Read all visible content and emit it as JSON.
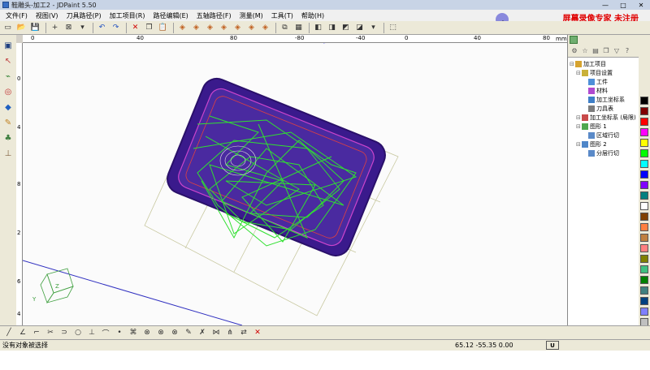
{
  "window": {
    "title": "鞋雕头-加工2 - JDPaint 5.50",
    "min": "—",
    "max": "□",
    "close": "✕"
  },
  "menu": [
    "文件(F)",
    "视图(V)",
    "刀具路径(P)",
    "加工项目(R)",
    "路径编辑(E)",
    "五轴路径(F)",
    "测量(M)",
    "工具(T)",
    "帮助(H)"
  ],
  "watermark": "屏幕录像专家 未注册",
  "ruler": {
    "unit": "mm",
    "top_labels": [
      "0",
      "40",
      "80",
      "-80",
      "-40",
      "0",
      "40",
      "80"
    ],
    "left_labels": [
      "0",
      "4",
      "8",
      "2",
      "6",
      "4"
    ]
  },
  "tree": [
    {
      "label": "加工项目",
      "depth": 0,
      "icon": "folder-icon",
      "color": "#d6a32f"
    },
    {
      "label": "项目设置",
      "depth": 1,
      "icon": "settings-icon",
      "color": "#c9b13a"
    },
    {
      "label": "工件",
      "depth": 2,
      "icon": "workpiece-icon",
      "color": "#4e8fd8"
    },
    {
      "label": "材料",
      "depth": 2,
      "icon": "material-icon",
      "color": "#b04ad0"
    },
    {
      "label": "加工坐标系",
      "depth": 2,
      "icon": "coordinate-icon",
      "color": "#3f7fc7"
    },
    {
      "label": "刀具表",
      "depth": 2,
      "icon": "tool-table-icon",
      "color": "#7c7c7c"
    },
    {
      "label": "加工坐标系 (局限)",
      "depth": 1,
      "icon": "coordinate-icon",
      "color": "#c94a4a"
    },
    {
      "label": "图形 1",
      "depth": 1,
      "icon": "shape-icon",
      "color": "#4ea84e"
    },
    {
      "label": "区域行切",
      "depth": 2,
      "icon": "path-icon",
      "color": "#5a8ac8"
    },
    {
      "label": "图形 2",
      "depth": 1,
      "icon": "shape-icon",
      "color": "#4e86c8"
    },
    {
      "label": "分层行切",
      "depth": 2,
      "icon": "path-icon",
      "color": "#5a8ac8"
    }
  ],
  "palette": [
    "#000000",
    "#800000",
    "#ff0000",
    "#ff00ff",
    "#ffff00",
    "#00ff00",
    "#00ffff",
    "#0000ff",
    "#8000ff",
    "#008080",
    "#ffffff",
    "#804000",
    "#ff8040",
    "#c08040",
    "#ff8080",
    "#808000",
    "#40c080",
    "#008000",
    "#408080",
    "#004080",
    "#8080ff",
    "#c0c0c0",
    "#ffc0c0",
    "#c0ffc0",
    "#ff80c0"
  ],
  "status": {
    "message": "没有对象被选择",
    "coords": "65.12  -55.35  0.00",
    "unit": "U"
  },
  "icons": {
    "toolbar": [
      "new-icon",
      "open-icon",
      "save-icon",
      "crosshair-icon",
      "box-select-icon",
      "dropdown-icon",
      "undo-icon",
      "redo-icon",
      "delete-icon",
      "copy-icon",
      "paste-icon",
      "view-cube-1-icon",
      "view-cube-2-icon",
      "view-cube-3-icon",
      "view-cube-4-icon",
      "view-cube-5-icon",
      "view-cube-6-icon",
      "view-cube-7-icon",
      "layer-icon",
      "grid-icon",
      "shade-1-icon",
      "shade-2-icon",
      "shade-3-icon",
      "shade-4-icon",
      "dropdown-icon",
      "select-toggle-icon"
    ],
    "left": [
      "frame-icon",
      "pointer-icon",
      "path-tool-icon",
      "target-icon",
      "measure-icon",
      "paint-icon",
      "tree-tool-icon",
      "axis-icon"
    ],
    "bottom": [
      "line-icon",
      "angle-icon",
      "corner-icon",
      "trim-icon",
      "extend-icon",
      "circle-icon",
      "perpendicular-icon",
      "tangent-icon",
      "point-icon",
      "node-icon",
      "cross-1-icon",
      "cross-2-icon",
      "cross-3-icon",
      "edit-icon",
      "delete-node-icon",
      "merge-icon",
      "split-icon",
      "reverse-icon",
      "close-icon"
    ]
  }
}
